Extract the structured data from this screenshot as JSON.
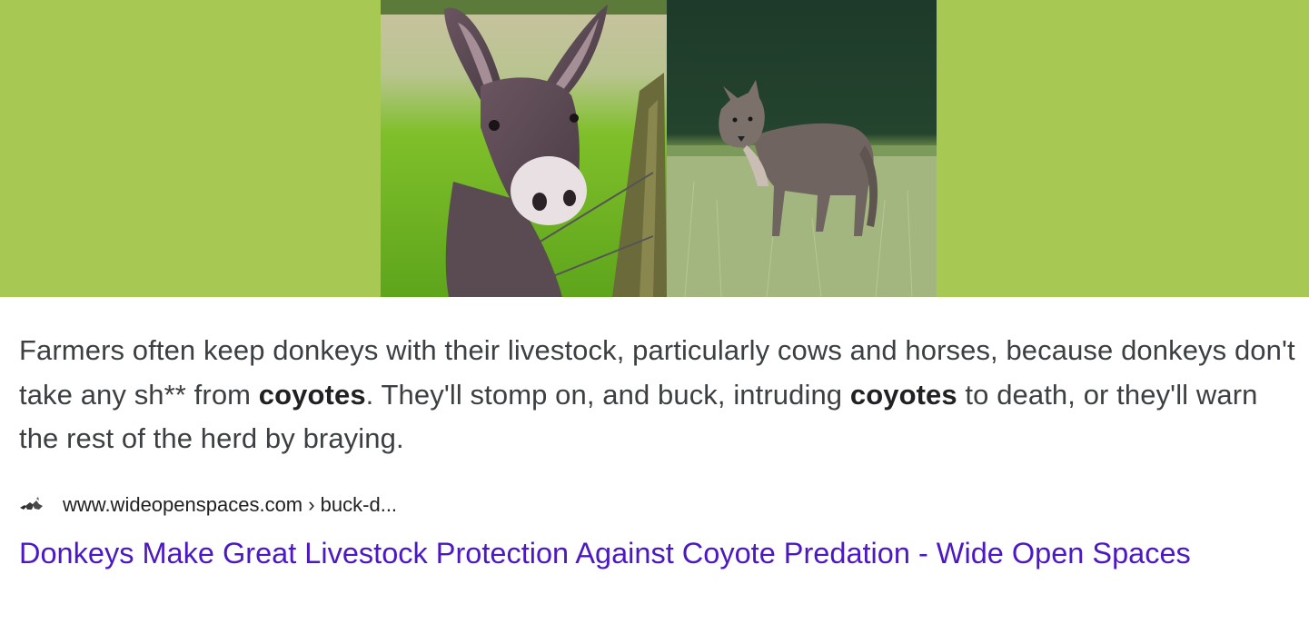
{
  "hero": {
    "background_color": "#a8c854",
    "images": [
      {
        "name": "donkey",
        "alt": "donkey photo"
      },
      {
        "name": "coyote",
        "alt": "coyote photo"
      }
    ]
  },
  "snippet": {
    "part1": "Farmers often keep donkeys with their livestock, particularly cows and horses, because donkeys don't take any sh** from ",
    "bold1": "coyotes",
    "part2": ". They'll stomp on, and buck, intruding ",
    "bold2": "coyotes",
    "part3": " to death, or they'll warn the rest of the herd by braying."
  },
  "source": {
    "favicon": "wideopenspaces-favicon",
    "url": "www.wideopenspaces.com › buck-d..."
  },
  "result": {
    "title": "Donkeys Make Great Livestock Protection Against Coyote Predation - Wide Open Spaces",
    "link_color": "#4b18c4"
  }
}
